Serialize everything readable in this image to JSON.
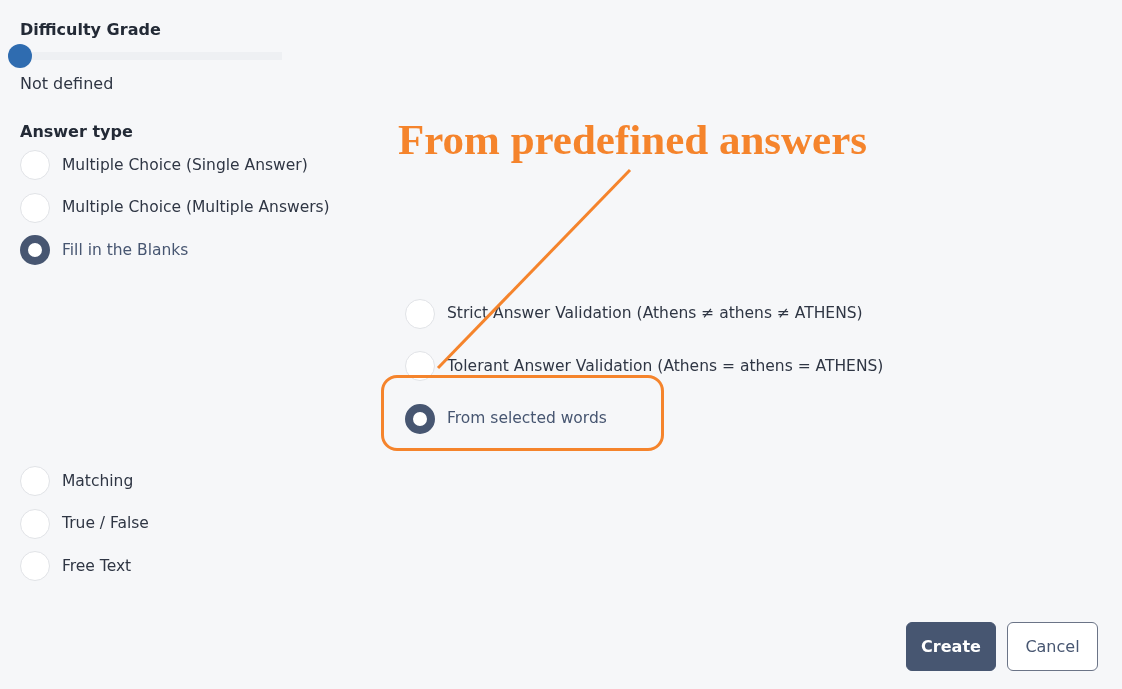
{
  "difficulty": {
    "label": "Difficulty Grade",
    "level": 0,
    "value_text": "Not defined"
  },
  "answer_type": {
    "label": "Answer type",
    "options": [
      {
        "label": "Multiple Choice (Single Answer)",
        "selected": false
      },
      {
        "label": "Multiple Choice (Multiple Answers)",
        "selected": false
      },
      {
        "label": "Fill in the Blanks",
        "selected": true,
        "children": [
          {
            "label": "Strict Answer Validation (Athens ≠ athens ≠ ATHENS)",
            "selected": false
          },
          {
            "label": "Tolerant Answer Validation (Athens = athens = ATHENS)",
            "selected": false
          },
          {
            "label": "From selected words",
            "selected": true,
            "highlighted": true
          }
        ]
      },
      {
        "label": "Matching",
        "selected": false
      },
      {
        "label": "True / False",
        "selected": false
      },
      {
        "label": "Free Text",
        "selected": false
      }
    ]
  },
  "annotation": {
    "text": "From predefined answers"
  },
  "buttons": [
    {
      "label": "Create",
      "kind": "primary"
    },
    {
      "label": "Cancel",
      "kind": "secondary"
    }
  ]
}
